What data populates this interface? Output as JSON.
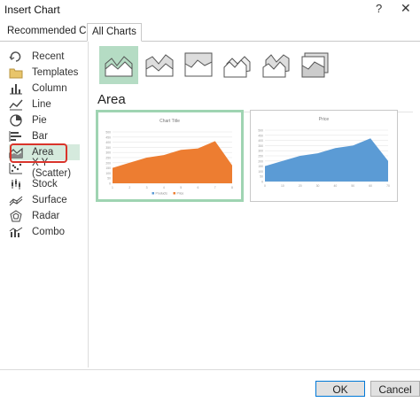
{
  "window": {
    "title": "Insert Chart",
    "help": "?",
    "close": "✕"
  },
  "tabs": [
    {
      "label": "Recommended Charts"
    },
    {
      "label": "All Charts"
    }
  ],
  "sidebar": {
    "items": [
      {
        "label": "Recent",
        "icon": "recent-icon"
      },
      {
        "label": "Templates",
        "icon": "templates-folder-icon"
      },
      {
        "label": "Column",
        "icon": "column-chart-icon"
      },
      {
        "label": "Line",
        "icon": "line-chart-icon"
      },
      {
        "label": "Pie",
        "icon": "pie-chart-icon"
      },
      {
        "label": "Bar",
        "icon": "bar-chart-icon"
      },
      {
        "label": "Area",
        "icon": "area-chart-icon",
        "selected": true
      },
      {
        "label": "X Y (Scatter)",
        "icon": "scatter-chart-icon"
      },
      {
        "label": "Stock",
        "icon": "stock-chart-icon"
      },
      {
        "label": "Surface",
        "icon": "surface-chart-icon"
      },
      {
        "label": "Radar",
        "icon": "radar-chart-icon"
      },
      {
        "label": "Combo",
        "icon": "combo-chart-icon"
      }
    ]
  },
  "main": {
    "section_title": "Area",
    "subtypes": [
      "area",
      "stacked-area",
      "100-percent-stacked-area",
      "3d-area",
      "3d-stacked-area",
      "3d-100-percent-stacked-area"
    ],
    "previews": [
      {
        "title": "Chart Title",
        "color": "#ed7d31",
        "yticks": [
          "500",
          "450",
          "400",
          "350",
          "300",
          "250",
          "200",
          "150",
          "100",
          "50",
          "0"
        ],
        "xticks": [
          "1",
          "2",
          "3",
          "4",
          "5",
          "6",
          "7",
          "8"
        ],
        "legend": [
          "Products",
          "Price"
        ]
      },
      {
        "title": "Price",
        "color": "#5b9bd5",
        "yticks": [
          "500",
          "450",
          "400",
          "350",
          "300",
          "250",
          "200",
          "150",
          "100",
          "50",
          "0"
        ],
        "xticks": [
          "0",
          "10",
          "20",
          "30",
          "40",
          "50",
          "60",
          "70"
        ]
      }
    ]
  },
  "buttons": {
    "ok": "OK",
    "cancel": "Cancel"
  },
  "colors": {
    "accent": "#217346",
    "selection": "#d5eadd",
    "highlight_box": "#d9342b"
  }
}
